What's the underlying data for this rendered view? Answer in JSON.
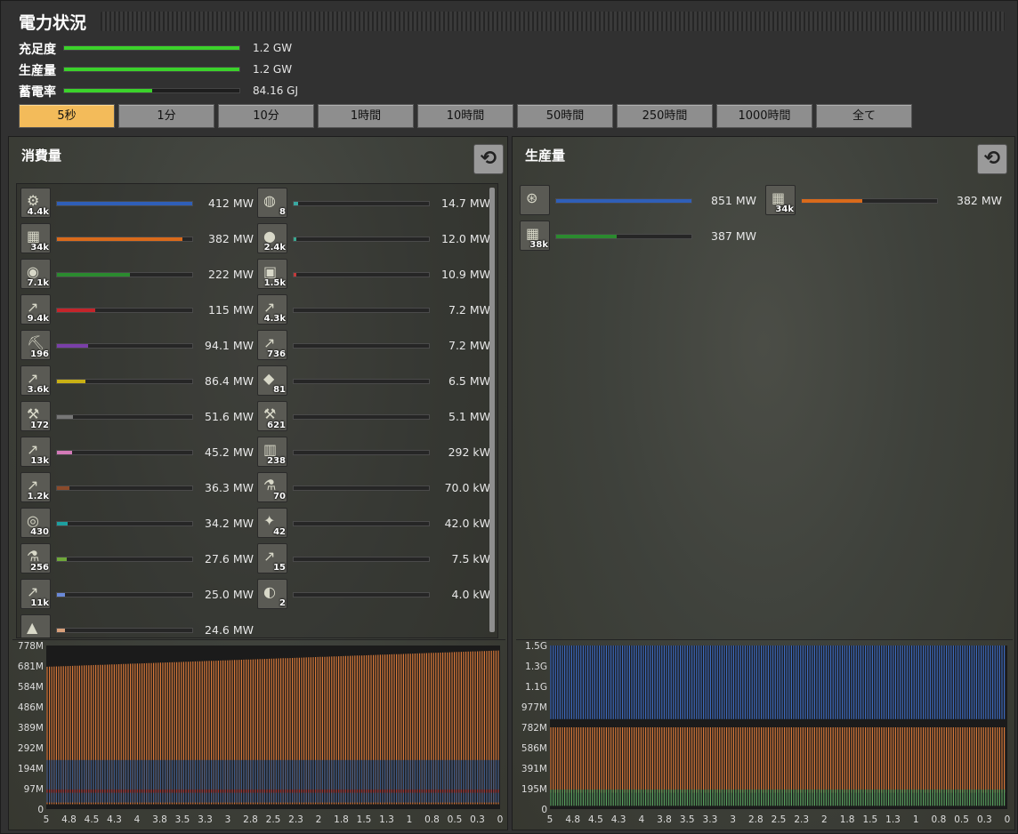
{
  "title": "電力状況",
  "stats": [
    {
      "label": "充足度",
      "value": "1.2 GW",
      "fill": 1.0
    },
    {
      "label": "生産量",
      "value": "1.2 GW",
      "fill": 1.0
    },
    {
      "label": "蓄電率",
      "value": "84.16 GJ",
      "fill": 0.5
    }
  ],
  "tabs": [
    {
      "label": "5秒",
      "active": true
    },
    {
      "label": "1分",
      "active": false
    },
    {
      "label": "10分",
      "active": false
    },
    {
      "label": "1時間",
      "active": false
    },
    {
      "label": "10時間",
      "active": false
    },
    {
      "label": "50時間",
      "active": false
    },
    {
      "label": "250時間",
      "active": false
    },
    {
      "label": "1000時間",
      "active": false
    },
    {
      "label": "全て",
      "active": false
    }
  ],
  "consumption": {
    "title": "消費量",
    "reset_icon": "reset-icon",
    "col1": [
      {
        "count": "4.4k",
        "value": "412 MW",
        "fill": 1.0,
        "color": "#2f5fb8",
        "icon": "assembler-icon"
      },
      {
        "count": "34k",
        "value": "382 MW",
        "fill": 0.93,
        "color": "#d96a1b",
        "icon": "accumulator-icon"
      },
      {
        "count": "7.1k",
        "value": "222 MW",
        "fill": 0.54,
        "color": "#2b8a2f",
        "icon": "beacon-icon"
      },
      {
        "count": "9.4k",
        "value": "115 MW",
        "fill": 0.28,
        "color": "#c4242a",
        "icon": "inserter-icon"
      },
      {
        "count": "196",
        "value": "94.1 MW",
        "fill": 0.23,
        "color": "#7a3fa8",
        "icon": "mining-drill-icon"
      },
      {
        "count": "3.6k",
        "value": "86.4 MW",
        "fill": 0.21,
        "color": "#c9b014",
        "icon": "fast-inserter-icon"
      },
      {
        "count": "172",
        "value": "51.6 MW",
        "fill": 0.12,
        "color": "#777777",
        "icon": "pumpjack-icon"
      },
      {
        "count": "13k",
        "value": "45.2 MW",
        "fill": 0.11,
        "color": "#d37ab8",
        "icon": "stack-inserter-icon"
      },
      {
        "count": "1.2k",
        "value": "36.3 MW",
        "fill": 0.09,
        "color": "#8a4a2a",
        "icon": "long-inserter-icon"
      },
      {
        "count": "430",
        "value": "34.2 MW",
        "fill": 0.08,
        "color": "#1ea0a0",
        "icon": "radar-icon"
      },
      {
        "count": "256",
        "value": "27.6 MW",
        "fill": 0.07,
        "color": "#6fa83a",
        "icon": "lab-icon"
      },
      {
        "count": "11k",
        "value": "25.0 MW",
        "fill": 0.06,
        "color": "#6a8ad8",
        "icon": "filter-inserter-icon"
      },
      {
        "count": "",
        "value": "24.6 MW",
        "fill": 0.06,
        "color": "#d8a07a",
        "icon": "furnace-icon"
      }
    ],
    "col2": [
      {
        "count": "8",
        "value": "14.7 MW",
        "fill": 0.03,
        "color": "#3aa8a0",
        "icon": "centrifuge-icon"
      },
      {
        "count": "2.4k",
        "value": "12.0 MW",
        "fill": 0.02,
        "color": "#3aa890",
        "icon": "lamp-icon"
      },
      {
        "count": "1.5k",
        "value": "10.9 MW",
        "fill": 0.02,
        "color": "#c43a3a",
        "icon": "roboport-icon"
      },
      {
        "count": "4.3k",
        "value": "7.2 MW",
        "fill": 0.0,
        "color": "#777777",
        "icon": "red-inserter-icon"
      },
      {
        "count": "736",
        "value": "7.2 MW",
        "fill": 0.0,
        "color": "#777777",
        "icon": "white-inserter-icon"
      },
      {
        "count": "81",
        "value": "6.5 MW",
        "fill": 0.0,
        "color": "#777777",
        "icon": "module-icon"
      },
      {
        "count": "621",
        "value": "5.1 MW",
        "fill": 0.0,
        "color": "#777777",
        "icon": "pump-icon"
      },
      {
        "count": "238",
        "value": "292 kW",
        "fill": 0.0,
        "color": "#777777",
        "icon": "refinery-icon"
      },
      {
        "count": "70",
        "value": "70.0 kW",
        "fill": 0.0,
        "color": "#777777",
        "icon": "chemical-plant-icon"
      },
      {
        "count": "42",
        "value": "42.0 kW",
        "fill": 0.0,
        "color": "#777777",
        "icon": "turret-icon"
      },
      {
        "count": "15",
        "value": "7.5 kW",
        "fill": 0.0,
        "color": "#777777",
        "icon": "purple-inserter-icon"
      },
      {
        "count": "2",
        "value": "4.0 kW",
        "fill": 0.0,
        "color": "#777777",
        "icon": "speaker-icon"
      }
    ],
    "yticks": [
      "778M",
      "681M",
      "584M",
      "486M",
      "389M",
      "292M",
      "194M",
      "97M",
      "0"
    ],
    "xticks": [
      "5",
      "4.8",
      "4.5",
      "4.3",
      "4",
      "3.8",
      "3.5",
      "3.3",
      "3",
      "2.8",
      "2.5",
      "2.3",
      "2",
      "1.8",
      "1.5",
      "1.3",
      "1",
      "0.8",
      "0.5",
      "0.3",
      "0"
    ]
  },
  "production": {
    "title": "生産量",
    "reset_icon": "reset-icon",
    "items": [
      {
        "count": "",
        "value": "851 MW",
        "fill": 1.0,
        "color": "#2f5fb8",
        "icon": "steam-turbine-icon"
      },
      {
        "count": "34k",
        "value": "382 MW",
        "fill": 0.45,
        "color": "#d96a1b",
        "icon": "accumulator-icon"
      },
      {
        "count": "38k",
        "value": "387 MW",
        "fill": 0.45,
        "color": "#2b8a2f",
        "icon": "solar-panel-icon"
      }
    ],
    "yticks": [
      "1.5G",
      "1.3G",
      "1.1G",
      "977M",
      "782M",
      "586M",
      "391M",
      "195M",
      "0"
    ],
    "xticks": [
      "5",
      "4.8",
      "4.5",
      "4.3",
      "4",
      "3.8",
      "3.5",
      "3.3",
      "3",
      "2.8",
      "2.5",
      "2.3",
      "2",
      "1.8",
      "1.5",
      "1.3",
      "1",
      "0.8",
      "0.5",
      "0.3",
      "0"
    ]
  }
}
